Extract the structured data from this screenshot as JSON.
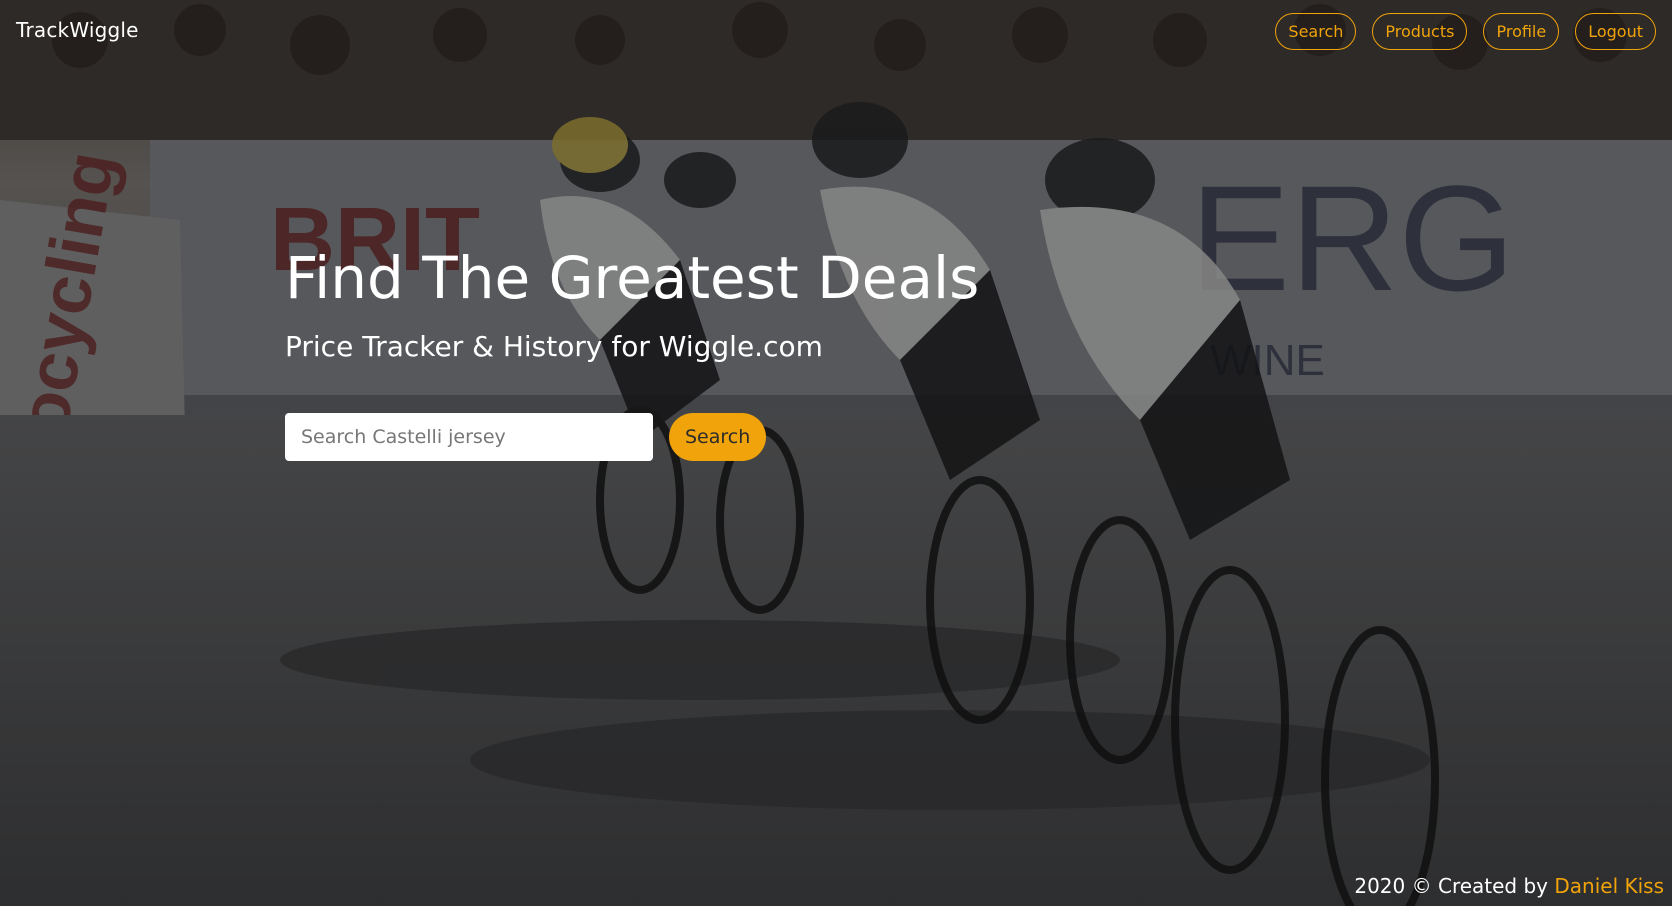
{
  "header": {
    "brand": "TrackWiggle",
    "nav": [
      {
        "label": "Search"
      },
      {
        "label": "Products"
      },
      {
        "label": "Profile"
      },
      {
        "label": "Logout"
      }
    ]
  },
  "hero": {
    "title": "Find The Greatest Deals",
    "subtitle": "Price Tracker & History for Wiggle.com",
    "search": {
      "placeholder": "Search Castelli jersey",
      "value": "",
      "button_label": "Search"
    },
    "background_image": "cyclists-racing-photo"
  },
  "footer": {
    "prefix": "2020 © Created by ",
    "author_link": "Daniel Kiss"
  },
  "colors": {
    "accent": "#f0a30a",
    "text": "#ffffff",
    "overlay": "rgba(0,0,0,0.38)"
  }
}
